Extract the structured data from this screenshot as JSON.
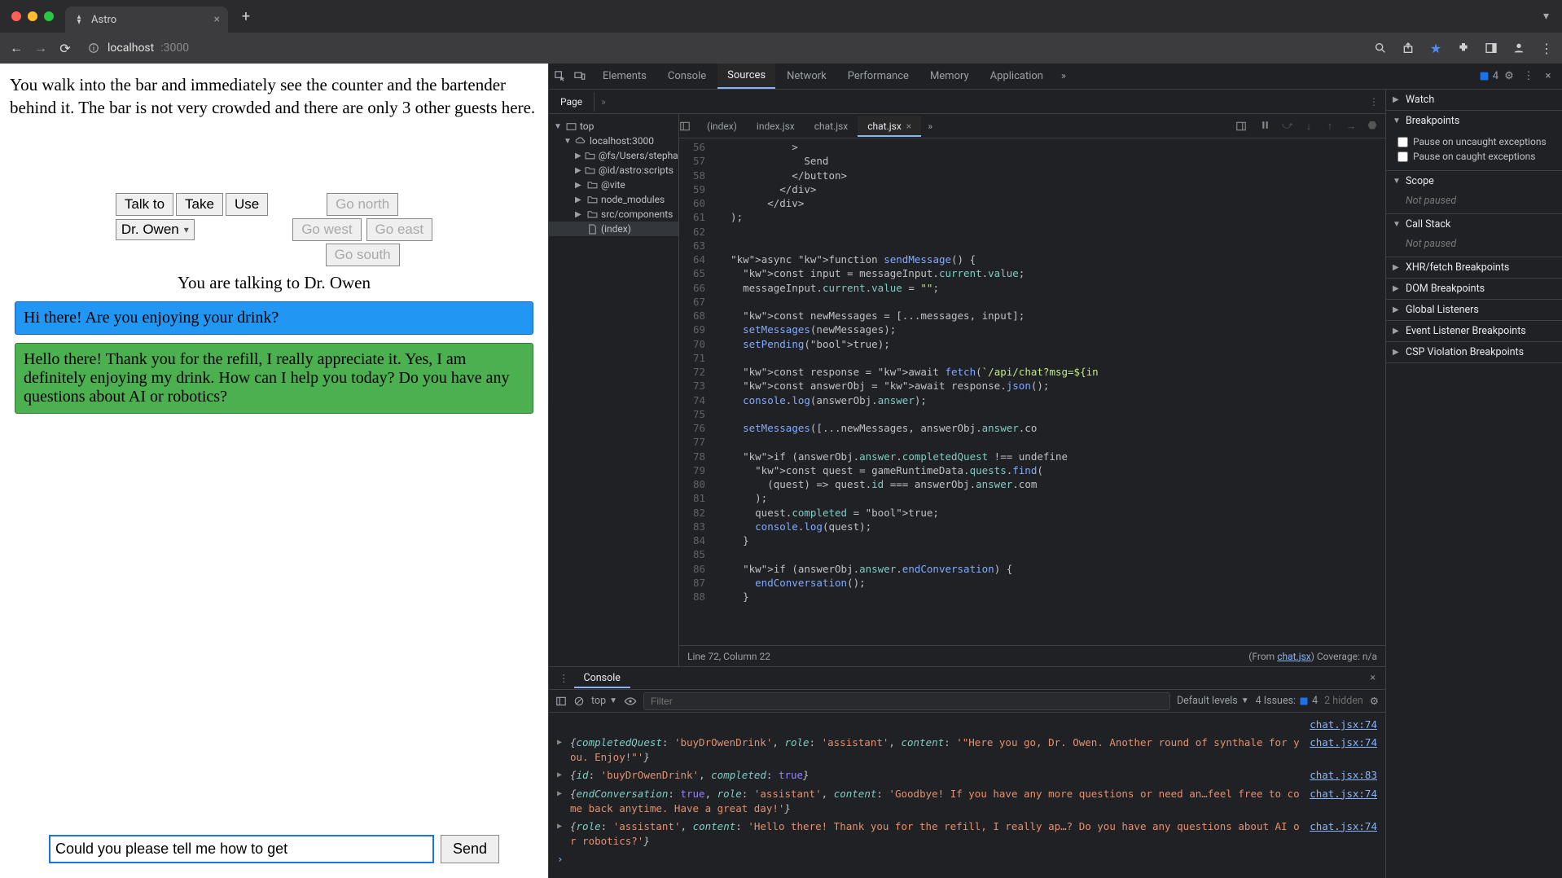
{
  "browser": {
    "tab_title": "Astro",
    "url_host": "localhost",
    "url_path": ":3000"
  },
  "devtools": {
    "tabs": [
      "Elements",
      "Console",
      "Sources",
      "Network",
      "Performance",
      "Memory",
      "Application"
    ],
    "active_tab": "Sources",
    "issues_count": "4",
    "page_pane_label": "Page",
    "file_tree": {
      "top": "top",
      "host": "localhost:3000",
      "items": [
        "@fs/Users/stepha",
        "@id/astro:scripts",
        "@vite",
        "node_modules",
        "src/components",
        "(index)"
      ]
    },
    "open_files": [
      "(index)",
      "index.jsx",
      "chat.jsx",
      "chat.jsx"
    ],
    "active_file_index": 3,
    "cursor_status": "Line 72, Column 22",
    "from_label": "(From ",
    "from_file": "chat.jsx",
    "coverage_label": ") Coverage: n/a",
    "code": {
      "lines": [
        {
          "n": 56,
          "t": "            >"
        },
        {
          "n": 57,
          "t": "              Send"
        },
        {
          "n": 58,
          "t": "            </button>"
        },
        {
          "n": 59,
          "t": "          </div>"
        },
        {
          "n": 60,
          "t": "        </div>"
        },
        {
          "n": 61,
          "t": "  );"
        },
        {
          "n": 62,
          "t": ""
        },
        {
          "n": 63,
          "t": ""
        },
        {
          "n": 64,
          "t": "  async function sendMessage() {"
        },
        {
          "n": 65,
          "t": "    const input = messageInput.current.value;"
        },
        {
          "n": 66,
          "t": "    messageInput.current.value = \"\";"
        },
        {
          "n": 67,
          "t": ""
        },
        {
          "n": 68,
          "t": "    const newMessages = [...messages, input];"
        },
        {
          "n": 69,
          "t": "    setMessages(newMessages);"
        },
        {
          "n": 70,
          "t": "    setPending(true);"
        },
        {
          "n": 71,
          "t": ""
        },
        {
          "n": 72,
          "t": "    const response = await fetch(`/api/chat?msg=${in"
        },
        {
          "n": 73,
          "t": "    const answerObj = await response.json();"
        },
        {
          "n": 74,
          "t": "    console.log(answerObj.answer);"
        },
        {
          "n": 75,
          "t": ""
        },
        {
          "n": 76,
          "t": "    setMessages([...newMessages, answerObj.answer.co"
        },
        {
          "n": 77,
          "t": ""
        },
        {
          "n": 78,
          "t": "    if (answerObj.answer.completedQuest !== undefine"
        },
        {
          "n": 79,
          "t": "      const quest = gameRuntimeData.quests.find("
        },
        {
          "n": 80,
          "t": "        (quest) => quest.id === answerObj.answer.com"
        },
        {
          "n": 81,
          "t": "      );"
        },
        {
          "n": 82,
          "t": "      quest.completed = true;"
        },
        {
          "n": 83,
          "t": "      console.log(quest);"
        },
        {
          "n": 84,
          "t": "    }"
        },
        {
          "n": 85,
          "t": ""
        },
        {
          "n": 86,
          "t": "    if (answerObj.answer.endConversation) {"
        },
        {
          "n": 87,
          "t": "      endConversation();"
        },
        {
          "n": 88,
          "t": "    }"
        }
      ]
    },
    "debug_panel": {
      "watch": "Watch",
      "breakpoints": "Breakpoints",
      "bp_uncaught": "Pause on uncaught exceptions",
      "bp_caught": "Pause on caught exceptions",
      "scope": "Scope",
      "not_paused": "Not paused",
      "call_stack": "Call Stack",
      "xhr": "XHR/fetch Breakpoints",
      "dom_bp": "DOM Breakpoints",
      "globals": "Global Listeners",
      "evt_bp": "Event Listener Breakpoints",
      "csp_bp": "CSP Violation Breakpoints"
    },
    "console": {
      "tab_label": "Console",
      "filter_placeholder": "Filter",
      "context": "top",
      "levels": "Default levels",
      "issues_label": "4 Issues:",
      "issues_n": "4",
      "hidden": "2 hidden",
      "logs": [
        {
          "src": "chat.jsx:74",
          "text": "{completedQuest: 'buyDrOwenDrink', role: 'assistant', content: '\"Here you go, Dr. Owen. Another round of synthale for you. Enjoy!\"'}"
        },
        {
          "src": "chat.jsx:83",
          "text": "{id: 'buyDrOwenDrink', completed: true}"
        },
        {
          "src": "chat.jsx:74",
          "text": "{endConversation: true, role: 'assistant', content: 'Goodbye! If you have any more questions or need an…feel free to come back anytime. Have a great day!'}"
        },
        {
          "src": "chat.jsx:74",
          "text": "{role: 'assistant', content: 'Hello there! Thank you for the refill, I really ap…? Do you have any questions about AI or robotics?'}"
        }
      ]
    }
  },
  "game": {
    "narration": "You walk into the bar and immediately see the counter and the bartender behind it. The bar is not very crowded and there are only 3 other guests here.",
    "actions": {
      "talk": "Talk to",
      "take": "Take",
      "use": "Use"
    },
    "npc_select": "Dr. Owen",
    "dirs": {
      "n": "Go north",
      "w": "Go west",
      "e": "Go east",
      "s": "Go south"
    },
    "talking_label": "You are talking to Dr. Owen",
    "msgs": [
      "Hi there! Are you enjoying your drink?",
      "Hello there! Thank you for the refill, I really appreciate it. Yes, I am definitely enjoying my drink. How can I help you today? Do you have any questions about AI or robotics?"
    ],
    "input_value": "Could you please tell me how to get ",
    "send_label": "Send"
  }
}
